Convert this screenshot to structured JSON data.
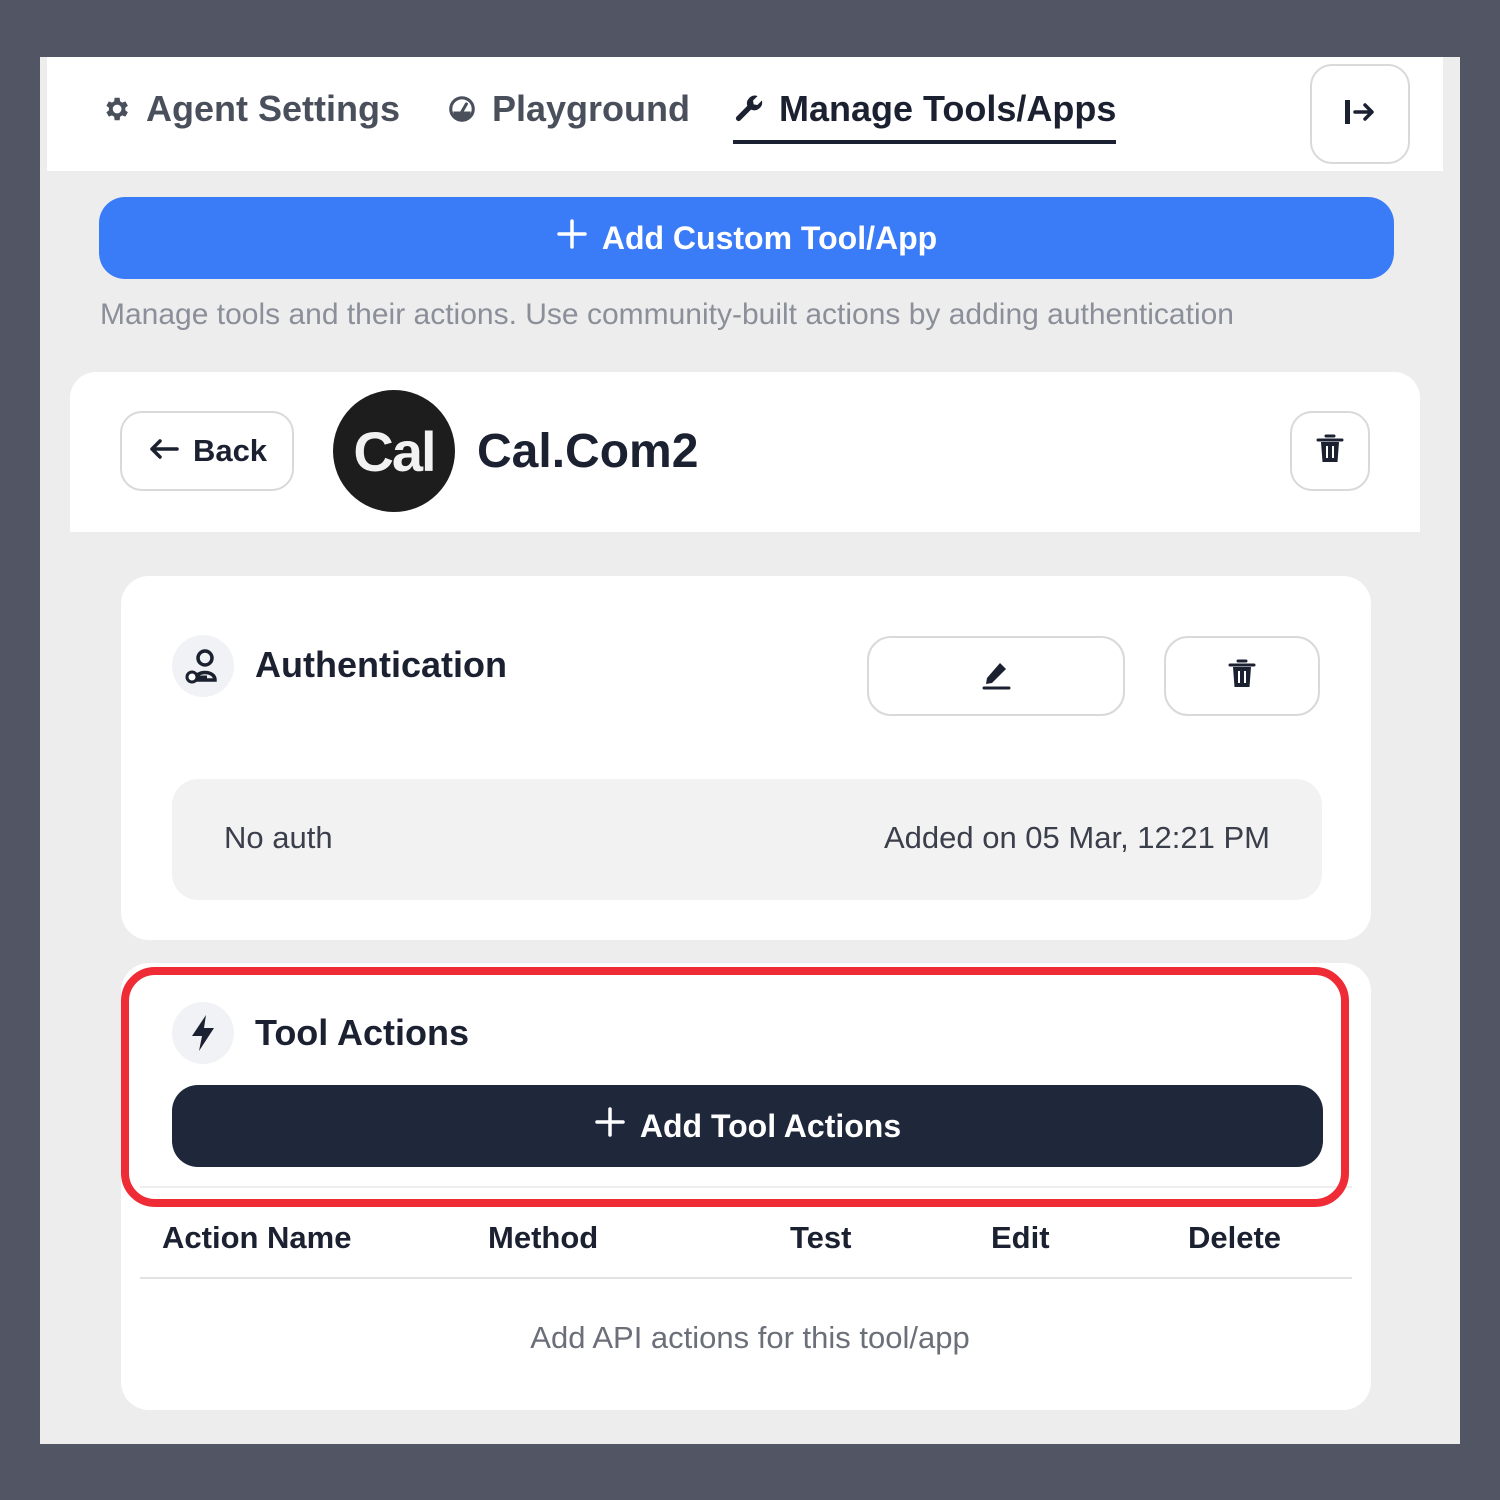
{
  "tabs": [
    {
      "label": "Agent Settings",
      "icon": "gear-icon",
      "active": false
    },
    {
      "label": "Playground",
      "icon": "gauge-icon",
      "active": false
    },
    {
      "label": "Manage Tools/Apps",
      "icon": "wrench-icon",
      "active": true
    }
  ],
  "header": {
    "exit_icon": "exit-icon"
  },
  "add_custom_button": {
    "label": "Add Custom Tool/App",
    "icon": "plus-icon"
  },
  "hint": "Manage tools and their actions. Use community-built actions by adding authentication",
  "tool": {
    "back_label": "Back",
    "logo_text": "Cal",
    "name": "Cal.Com2"
  },
  "authentication": {
    "title": "Authentication",
    "type": "No auth",
    "added": "Added on 05 Mar, 12:21 PM"
  },
  "tool_actions": {
    "title": "Tool Actions",
    "add_label": "Add Tool Actions",
    "columns": [
      "Action Name",
      "Method",
      "Test",
      "Edit",
      "Delete"
    ],
    "empty_message": "Add API actions for this tool/app"
  },
  "colors": {
    "primary_blue": "#3a7bf7",
    "dark_button": "#1e283a",
    "highlight_red": "#ef2b35",
    "background": "#525664"
  }
}
